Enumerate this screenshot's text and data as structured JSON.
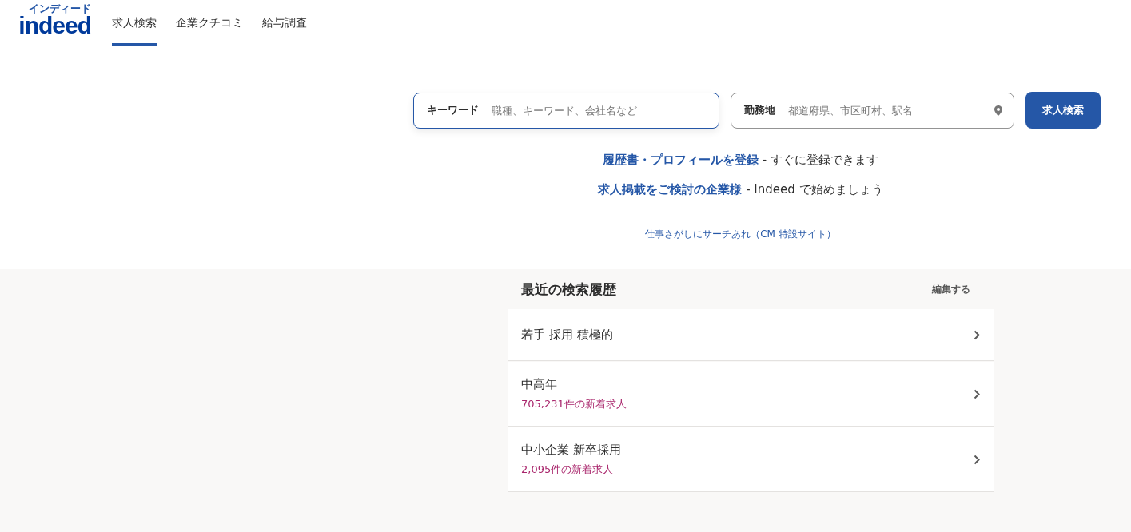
{
  "logo": {
    "wordmark": "indeed",
    "katakana": "インディード"
  },
  "nav": [
    {
      "label": "求人検索",
      "selected": true
    },
    {
      "label": "企業クチコミ",
      "selected": false
    },
    {
      "label": "給与調査",
      "selected": false
    }
  ],
  "search": {
    "keyword": {
      "label": "キーワード",
      "placeholder": "職種、キーワード、会社名など"
    },
    "location": {
      "label": "勤務地",
      "placeholder": "都道府県、市区町村、駅名"
    },
    "button": "求人検索"
  },
  "promos": [
    {
      "link": "履歴書・プロフィールを登録",
      "text": " - すぐに登録できます"
    },
    {
      "link": "求人掲載をご検討の企業様",
      "text": " - Indeed で始めましょう"
    }
  ],
  "cm_link": "仕事さがしにサーチあれ（CM 特設サイト）",
  "history": {
    "title": "最近の検索履歴",
    "edit": "編集する",
    "items": [
      {
        "query": "若手 採用 積極的"
      },
      {
        "query": "中高年",
        "count": "705,231件の新着求人"
      },
      {
        "query": "中小企業 新卒採用",
        "count": "2,095件の新着求人"
      }
    ]
  }
}
